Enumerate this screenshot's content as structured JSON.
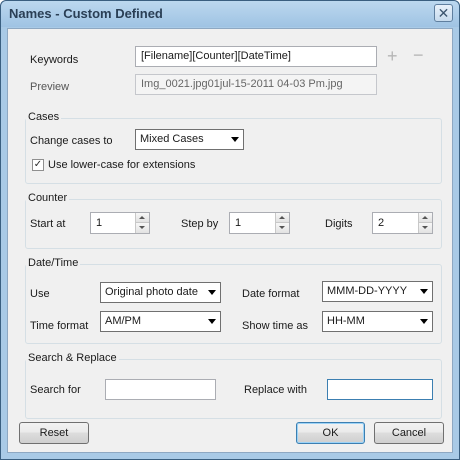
{
  "window": {
    "title": "Names - Custom Defined",
    "close_glyph": "✕"
  },
  "top": {
    "keywords_label": "Keywords",
    "keywords_value": "[Filename][Counter][DateTime]",
    "preview_label": "Preview",
    "preview_value": "Img_0021.jpg01jul-15-2011 04-03 Pm.jpg",
    "add_glyph": "+",
    "remove_glyph": "−"
  },
  "cases": {
    "group_title": "Cases",
    "change_label": "Change cases to",
    "change_value": "Mixed Cases",
    "lowercase_checked": true,
    "lowercase_label": "Use lower-case for extensions",
    "check_glyph": "✓"
  },
  "counter": {
    "group_title": "Counter",
    "start_label": "Start at",
    "start_value": "1",
    "step_label": "Step by",
    "step_value": "1",
    "digits_label": "Digits",
    "digits_value": "2"
  },
  "datetime": {
    "group_title": "Date/Time",
    "use_label": "Use",
    "use_value": "Original photo date",
    "date_format_label": "Date format",
    "date_format_value": "MMM-DD-YYYY",
    "time_format_label": "Time format",
    "time_format_value": "AM/PM",
    "show_time_label": "Show time as",
    "show_time_value": "HH-MM"
  },
  "search": {
    "group_title": "Search & Replace",
    "search_label": "Search for",
    "search_value": "",
    "replace_label": "Replace with",
    "replace_value": ""
  },
  "buttons": {
    "reset": "Reset",
    "ok": "OK",
    "cancel": "Cancel"
  }
}
